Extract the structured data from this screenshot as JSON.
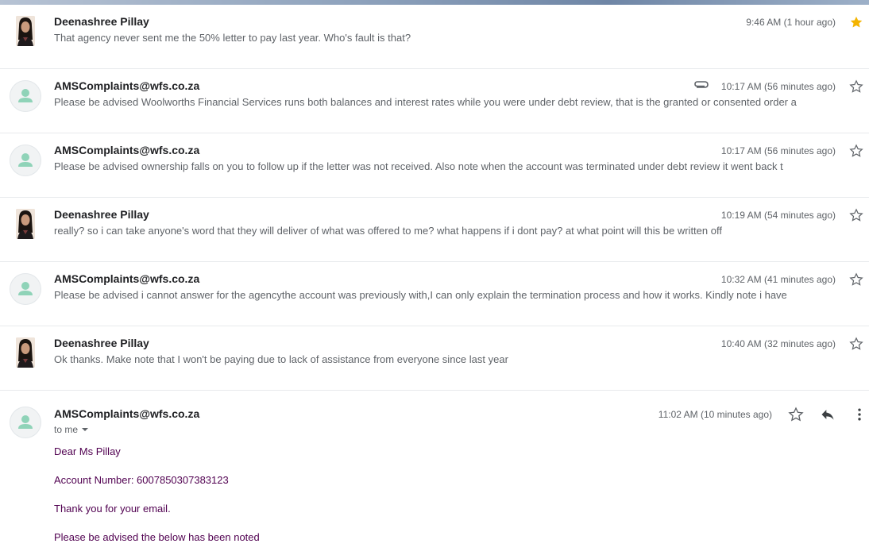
{
  "thread": {
    "messages": [
      {
        "sender": "Deenashree Pillay",
        "avatar": "photo",
        "snippet": "That agency never sent me the 50% letter to pay last year. Who's fault is that?",
        "time": "9:46 AM (1 hour ago)",
        "starred": true,
        "attachment": false
      },
      {
        "sender": "AMSComplaints@wfs.co.za",
        "avatar": "generic",
        "snippet": "Please be advised Woolworths Financial Services runs both balances and interest rates while you were under debt review, that is the granted or consented order a",
        "time": "10:17 AM (56 minutes ago)",
        "starred": false,
        "attachment": true
      },
      {
        "sender": "AMSComplaints@wfs.co.za",
        "avatar": "generic",
        "snippet": "Please be advised ownership falls on you to follow up if the letter was not received. Also note when the account was terminated under debt review it went back t",
        "time": "10:17 AM (56 minutes ago)",
        "starred": false,
        "attachment": false
      },
      {
        "sender": "Deenashree Pillay",
        "avatar": "photo",
        "snippet": "really? so i can take anyone's word that they will deliver of what was offered to me? what happens if i dont pay? at what point will this be written off",
        "time": "10:19 AM (54 minutes ago)",
        "starred": false,
        "attachment": false
      },
      {
        "sender": "AMSComplaints@wfs.co.za",
        "avatar": "generic",
        "snippet": "Please be advised i cannot answer for the agencythe account was previously with,I can only explain the termination process and how it works. Kindly note i have",
        "time": "10:32 AM (41 minutes ago)",
        "starred": false,
        "attachment": false
      },
      {
        "sender": "Deenashree Pillay",
        "avatar": "photo",
        "snippet": "Ok thanks. Make note that I won't be paying due to lack of assistance from everyone since last year",
        "time": "10:40 AM (32 minutes ago)",
        "starred": false,
        "attachment": false
      }
    ],
    "expanded": {
      "sender": "AMSComplaints@wfs.co.za",
      "time": "11:02 AM (10 minutes ago)",
      "to_label": "to me",
      "body": [
        "Dear Ms Pillay",
        "Account Number: 6007850307383123",
        "Thank you for your email.",
        "Please be advised the below has been noted"
      ]
    }
  },
  "colors": {
    "star_active": "#f4b400",
    "generic_avatar_figure": "#8fd3b8",
    "quoted_text": "#500050"
  },
  "icons": {
    "star": "star-icon",
    "attachment": "paperclip-icon",
    "reply": "reply-icon",
    "more": "more-vert-icon",
    "dropdown": "caret-down-icon"
  }
}
